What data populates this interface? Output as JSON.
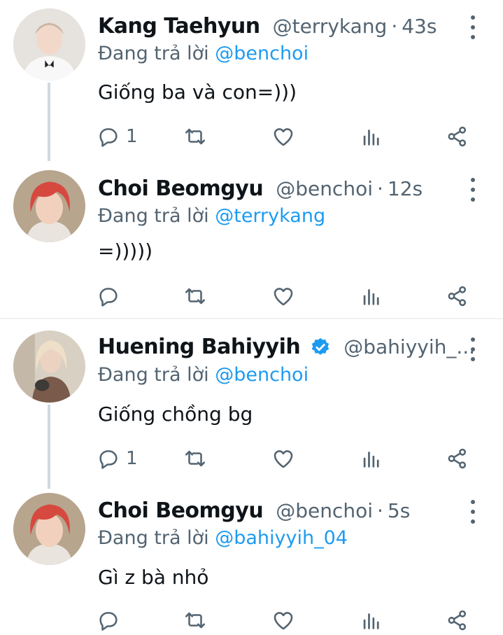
{
  "reply_prefix": "Đang trả lời",
  "tweets": [
    {
      "name": "Kang Taehyun",
      "handle": "@terrykang",
      "time": "43s",
      "reply_to": "@benchoi",
      "text": "Giống ba và con=)))",
      "reply_count": "1",
      "verified": false,
      "avatar": "white-shirt-person-avatar"
    },
    {
      "name": "Choi Beomgyu",
      "handle": "@benchoi",
      "time": "12s",
      "reply_to": "@terrykang",
      "text": "=)))))",
      "reply_count": "",
      "verified": false,
      "avatar": "red-hair-person-avatar"
    },
    {
      "name": "Huening Bahiyyih",
      "handle": "@bahiyyih_...",
      "time": "",
      "reply_to": "@benchoi",
      "text": "Giống chồng bg",
      "reply_count": "1",
      "verified": true,
      "avatar": "blonde-person-avatar"
    },
    {
      "name": "Choi Beomgyu",
      "handle": "@benchoi",
      "time": "5s",
      "reply_to": "@bahiyyih_04",
      "text": "Gì z bà nhỏ",
      "reply_count": "",
      "verified": false,
      "avatar": "red-hair-person-avatar"
    }
  ],
  "colors": {
    "link": "#1d9bf0",
    "secondary_text": "#536471",
    "primary_text": "#0f1419",
    "thread_line": "#cfd9de",
    "divider": "#eff3f4"
  }
}
